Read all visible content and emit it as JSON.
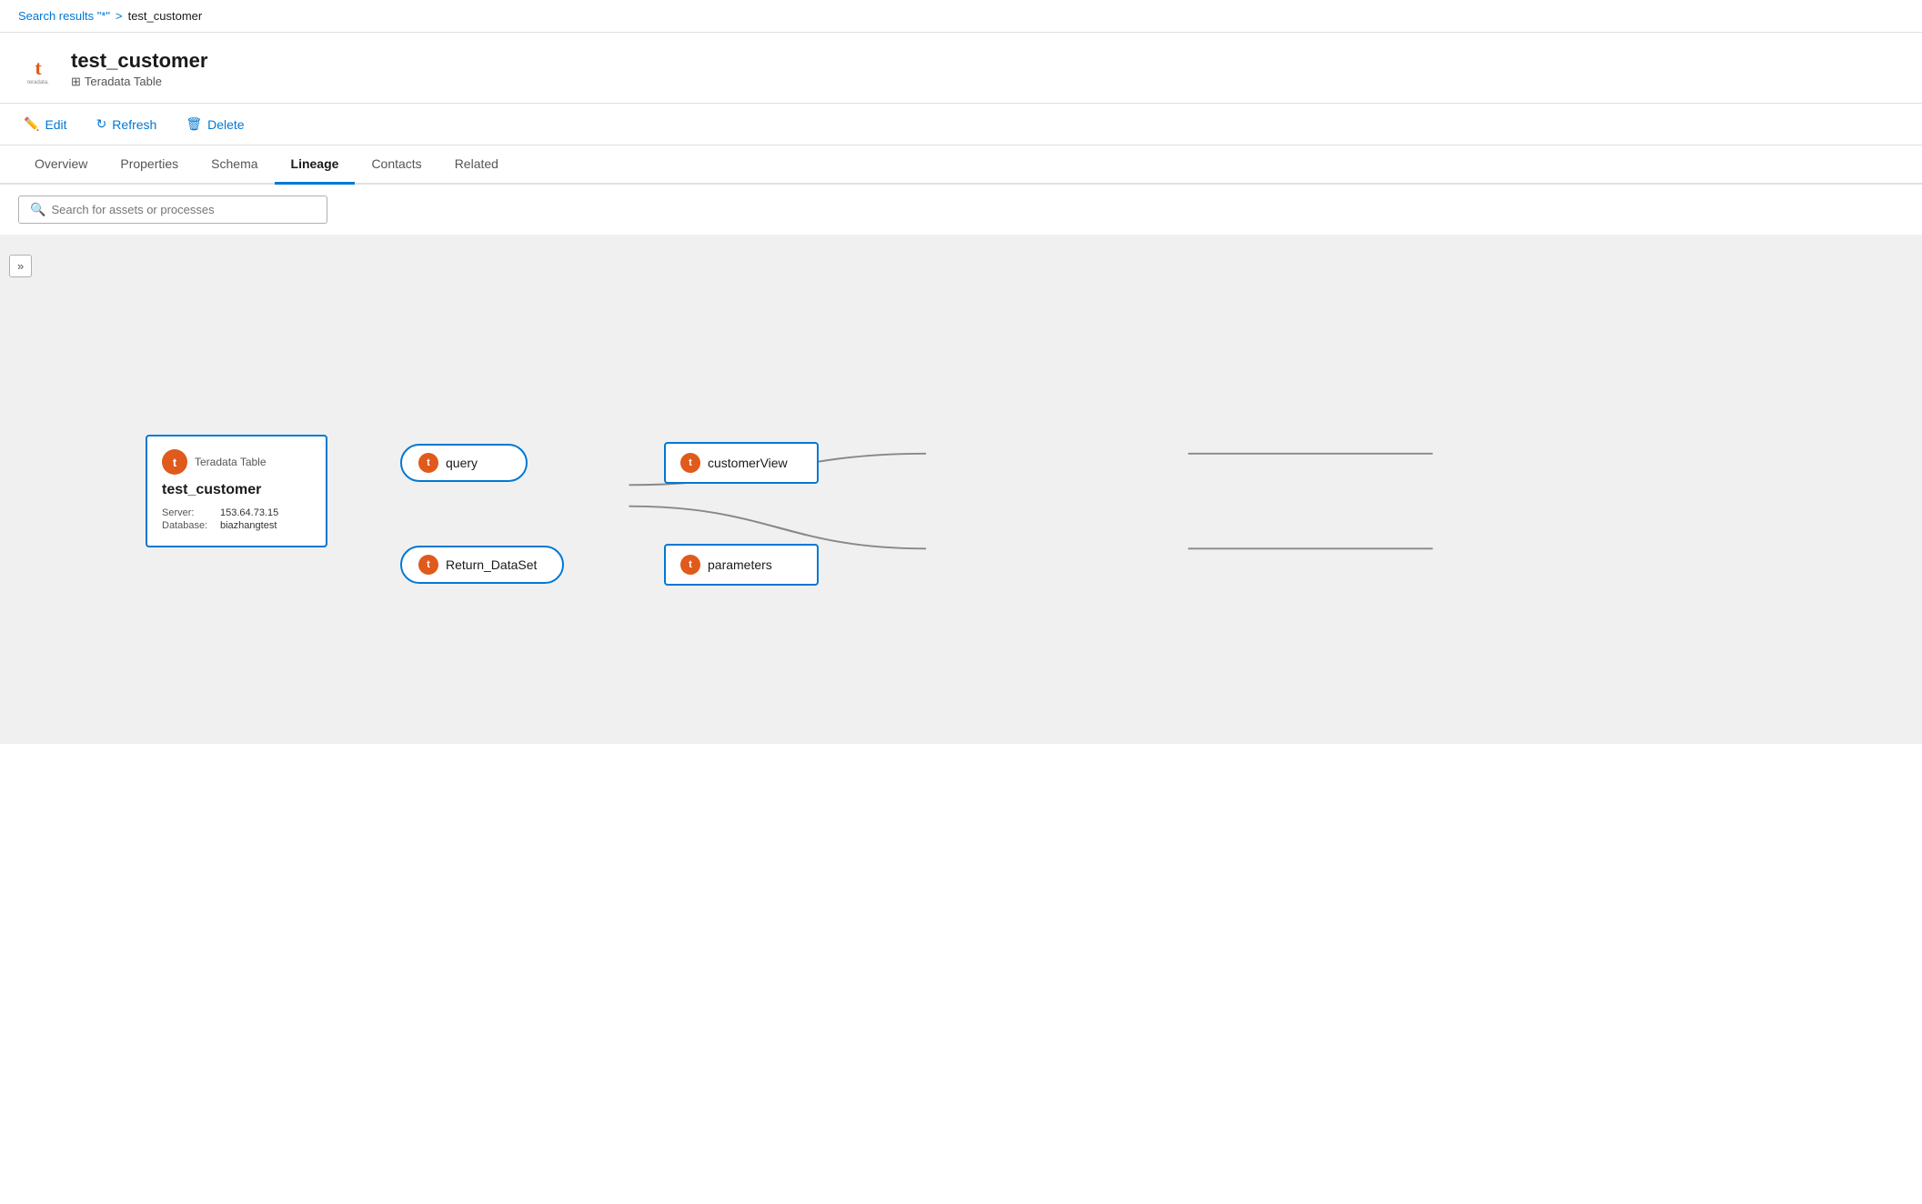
{
  "breadcrumb": {
    "search_label": "Search results \"*\"",
    "separator": ">",
    "current": "test_customer"
  },
  "asset": {
    "title": "test_customer",
    "subtitle": "Teradata Table",
    "logo_alt": "Teradata logo"
  },
  "toolbar": {
    "edit_label": "Edit",
    "refresh_label": "Refresh",
    "delete_label": "Delete"
  },
  "tabs": [
    {
      "id": "overview",
      "label": "Overview",
      "active": false
    },
    {
      "id": "properties",
      "label": "Properties",
      "active": false
    },
    {
      "id": "schema",
      "label": "Schema",
      "active": false
    },
    {
      "id": "lineage",
      "label": "Lineage",
      "active": true
    },
    {
      "id": "contacts",
      "label": "Contacts",
      "active": false
    },
    {
      "id": "related",
      "label": "Related",
      "active": false
    }
  ],
  "search": {
    "placeholder": "Search for assets or processes"
  },
  "expand_btn": "»",
  "lineage": {
    "source_node": {
      "type": "Teradata Table",
      "name": "test_customer",
      "server_label": "Server:",
      "server_value": "153.64.73.15",
      "database_label": "Database:",
      "database_value": "biazhangtest"
    },
    "process_nodes": [
      {
        "id": "query",
        "label": "query"
      },
      {
        "id": "return_dataset",
        "label": "Return_DataSet"
      }
    ],
    "output_nodes": [
      {
        "id": "customerview",
        "label": "customerView"
      },
      {
        "id": "parameters",
        "label": "parameters"
      }
    ]
  },
  "icons": {
    "table_icon": "⊞",
    "t_letter": "t"
  }
}
